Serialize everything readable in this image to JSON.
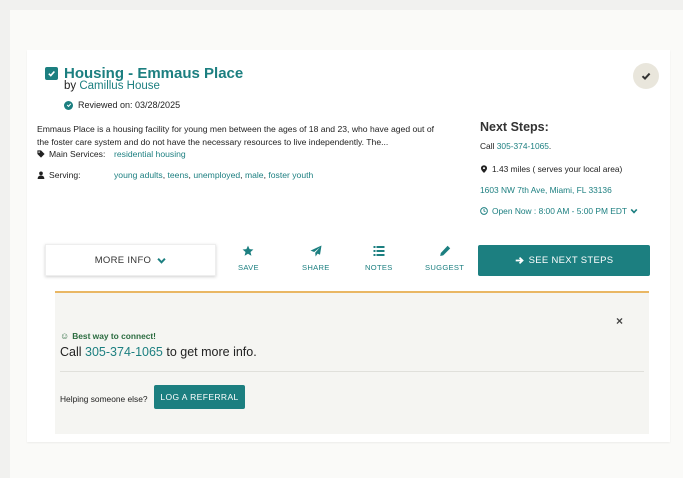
{
  "listing": {
    "title": "Housing - Emmaus Place",
    "by_prefix": "by",
    "provider": "Camillus House",
    "reviewed": "Reviewed on: 03/28/2025",
    "description_line1": "Emmaus Place is a housing facility for young men between the ages of 18 and 23, who have aged out of",
    "description_line2": "the foster care system and do not have the necessary resources to live independently. The...",
    "services_label": "Main Services:",
    "services": "residential housing",
    "serving_label": "Serving:",
    "serving": [
      "young adults",
      "teens",
      "unemployed",
      "male",
      "foster youth"
    ]
  },
  "next_steps": {
    "title": "Next Steps:",
    "call_prefix": "Call",
    "phone": "305-374-1065",
    "distance": "1.43 miles ( serves your local area)",
    "address": "1603 NW 7th Ave, Miami, FL 33136",
    "open_label": "Open Now :",
    "hours": "8:00 AM - 5:00 PM EDT"
  },
  "actions": {
    "more_info": "MORE INFO",
    "save": "SAVE",
    "share": "SHARE",
    "notes": "NOTES",
    "suggest": "SUGGEST",
    "see_next_steps": "SEE NEXT STEPS"
  },
  "panel": {
    "close": "×",
    "best_way": "Best way to connect!",
    "call_prefix": "Call",
    "phone": "305-374-1065",
    "call_suffix": "to get more info.",
    "helping": "Helping someone else?",
    "log_referral": "LOG A REFERRAL"
  },
  "colors": {
    "accent": "#1c7f80",
    "panel_border": "#e9b764",
    "best_way_green": "#2a6b3f"
  },
  "icons": [
    "checkbox-checked-icon",
    "check-circle-icon",
    "checkmark-icon",
    "tag-icon",
    "user-icon",
    "map-marker-icon",
    "clock-icon",
    "chevron-down-icon",
    "star-icon",
    "paper-plane-icon",
    "list-icon",
    "pencil-icon",
    "arrow-right-icon",
    "smile-icon",
    "close-icon"
  ]
}
